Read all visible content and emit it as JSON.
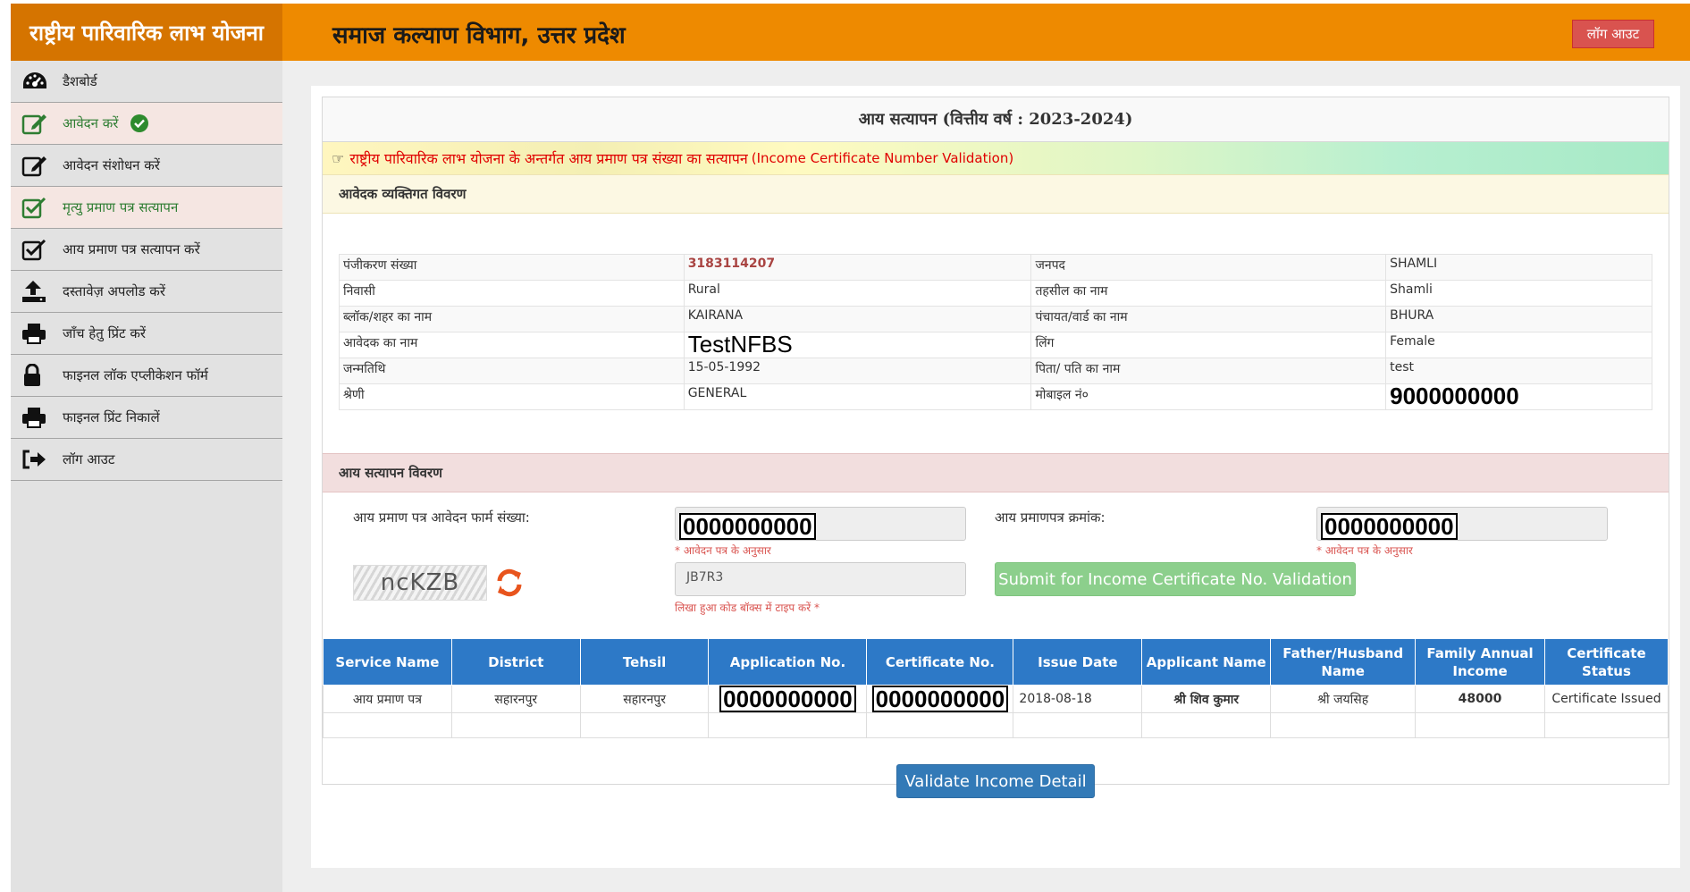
{
  "header": {
    "brand": "राष्ट्रीय पारिवारिक लाभ योजना",
    "department": "समाज कल्याण विभाग, उत्तर प्रदेश",
    "logout_label": "लॉग आउट"
  },
  "sidebar": {
    "items": [
      {
        "label": "डैशबोर्ड",
        "icon": "dashboard-icon"
      },
      {
        "label": "आवेदन करें",
        "icon": "edit-icon"
      },
      {
        "label": "आवेदन संशोधन करें",
        "icon": "edit-icon"
      },
      {
        "label": "मृत्यु प्रमाण पत्र सत्यापन",
        "icon": "checkbox-icon"
      },
      {
        "label": "आय प्रमाण पत्र सत्यापन करें",
        "icon": "checkbox-icon"
      },
      {
        "label": "दस्तावेज़ अपलोड करें",
        "icon": "upload-icon"
      },
      {
        "label": "जाँच हेतु प्रिंट करें",
        "icon": "print-icon"
      },
      {
        "label": "फाइनल लॉक एप्लीकेशन फॉर्म",
        "icon": "lock-icon"
      },
      {
        "label": "फाइनल प्रिंट निकालें",
        "icon": "print-icon"
      },
      {
        "label": "लॉग आउट",
        "icon": "sign-out-icon"
      }
    ]
  },
  "page": {
    "title": "आय सत्यापन (वित्तीय वर्ष : 2023-2024)",
    "banner_hi": "राष्ट्रीय पारिवारिक लाभ योजना के अन्तर्गत आय प्रमाण पत्र संख्या का सत्यापन",
    "banner_en": "(Income Certificate Number Validation)",
    "personal_section": "आवेदक व्यक्तिगत विवरण",
    "income_section": "आय सत्यापन विवरण"
  },
  "personal": {
    "reg_label": "पंजीकरण संख्या",
    "reg_value": "3183114207",
    "district_label": "जनपद",
    "district_value": "SHAMLI",
    "resident_label": "निवासी",
    "resident_value": "Rural",
    "tehsil_label": "तहसील का नाम",
    "tehsil_value": "Shamli",
    "block_label": "ब्लॉक/शहर का नाम",
    "block_value": "KAIRANA",
    "panchayat_label": "पंचायत/वार्ड का नाम",
    "panchayat_value": "BHURA",
    "name_label": "आवेदक का नाम",
    "name_value": "TestNFBS",
    "gender_label": "लिंग",
    "gender_value": "Female",
    "dob_label": "जन्मतिथि",
    "dob_value": "15-05-1992",
    "father_label": "पिता/ पति का नाम",
    "father_value": "test",
    "category_label": "श्रेणी",
    "category_value": "GENERAL",
    "mobile_label": "मोबाइल नं०",
    "mobile_value": "9000000000"
  },
  "income_form": {
    "form_no_label": "आय प्रमाण पत्र आवेदन फार्म संख्या:",
    "form_no_value": "0000000000",
    "form_no_hint": "* आवेदन पत्र के अनुसार",
    "cert_no_label": "आय प्रमाणपत्र क्रमांक:",
    "cert_no_value": "0000000000",
    "cert_no_hint": "* आवेदन पत्र के अनुसार",
    "captcha_text": "ncKZB",
    "captcha_input": "JB7R3",
    "captcha_hint": "लिखा हुआ कोड बॉक्स में टाइप करें *",
    "submit_label": "Submit for Income Certificate No. Validation"
  },
  "results": {
    "headers": [
      "Service Name",
      "District",
      "Tehsil",
      "Application No.",
      "Certificate No.",
      "Issue Date",
      "Applicant Name",
      "Father/Husband Name",
      "Family Annual Income",
      "Certificate Status"
    ],
    "row": {
      "service": "आय प्रमाण पत्र",
      "district": "सहारनपुर",
      "tehsil": "सहारनपुर",
      "application_no": "0000000000",
      "certificate_no": "0000000000",
      "issue_date": "2018-08-18",
      "applicant": "श्री शिव कुमार",
      "father": "श्री जयसिह",
      "income": "48000",
      "status": "Certificate Issued"
    }
  },
  "validate_label": "Validate Income Detail",
  "colors": {
    "brand_bg": "#d57400",
    "topbar_bg": "#ee8a00",
    "table_header": "#2d79c7",
    "validate_button": "#337ab7",
    "submit_button": "#8ccf8c",
    "logout_button": "#d9534f"
  }
}
